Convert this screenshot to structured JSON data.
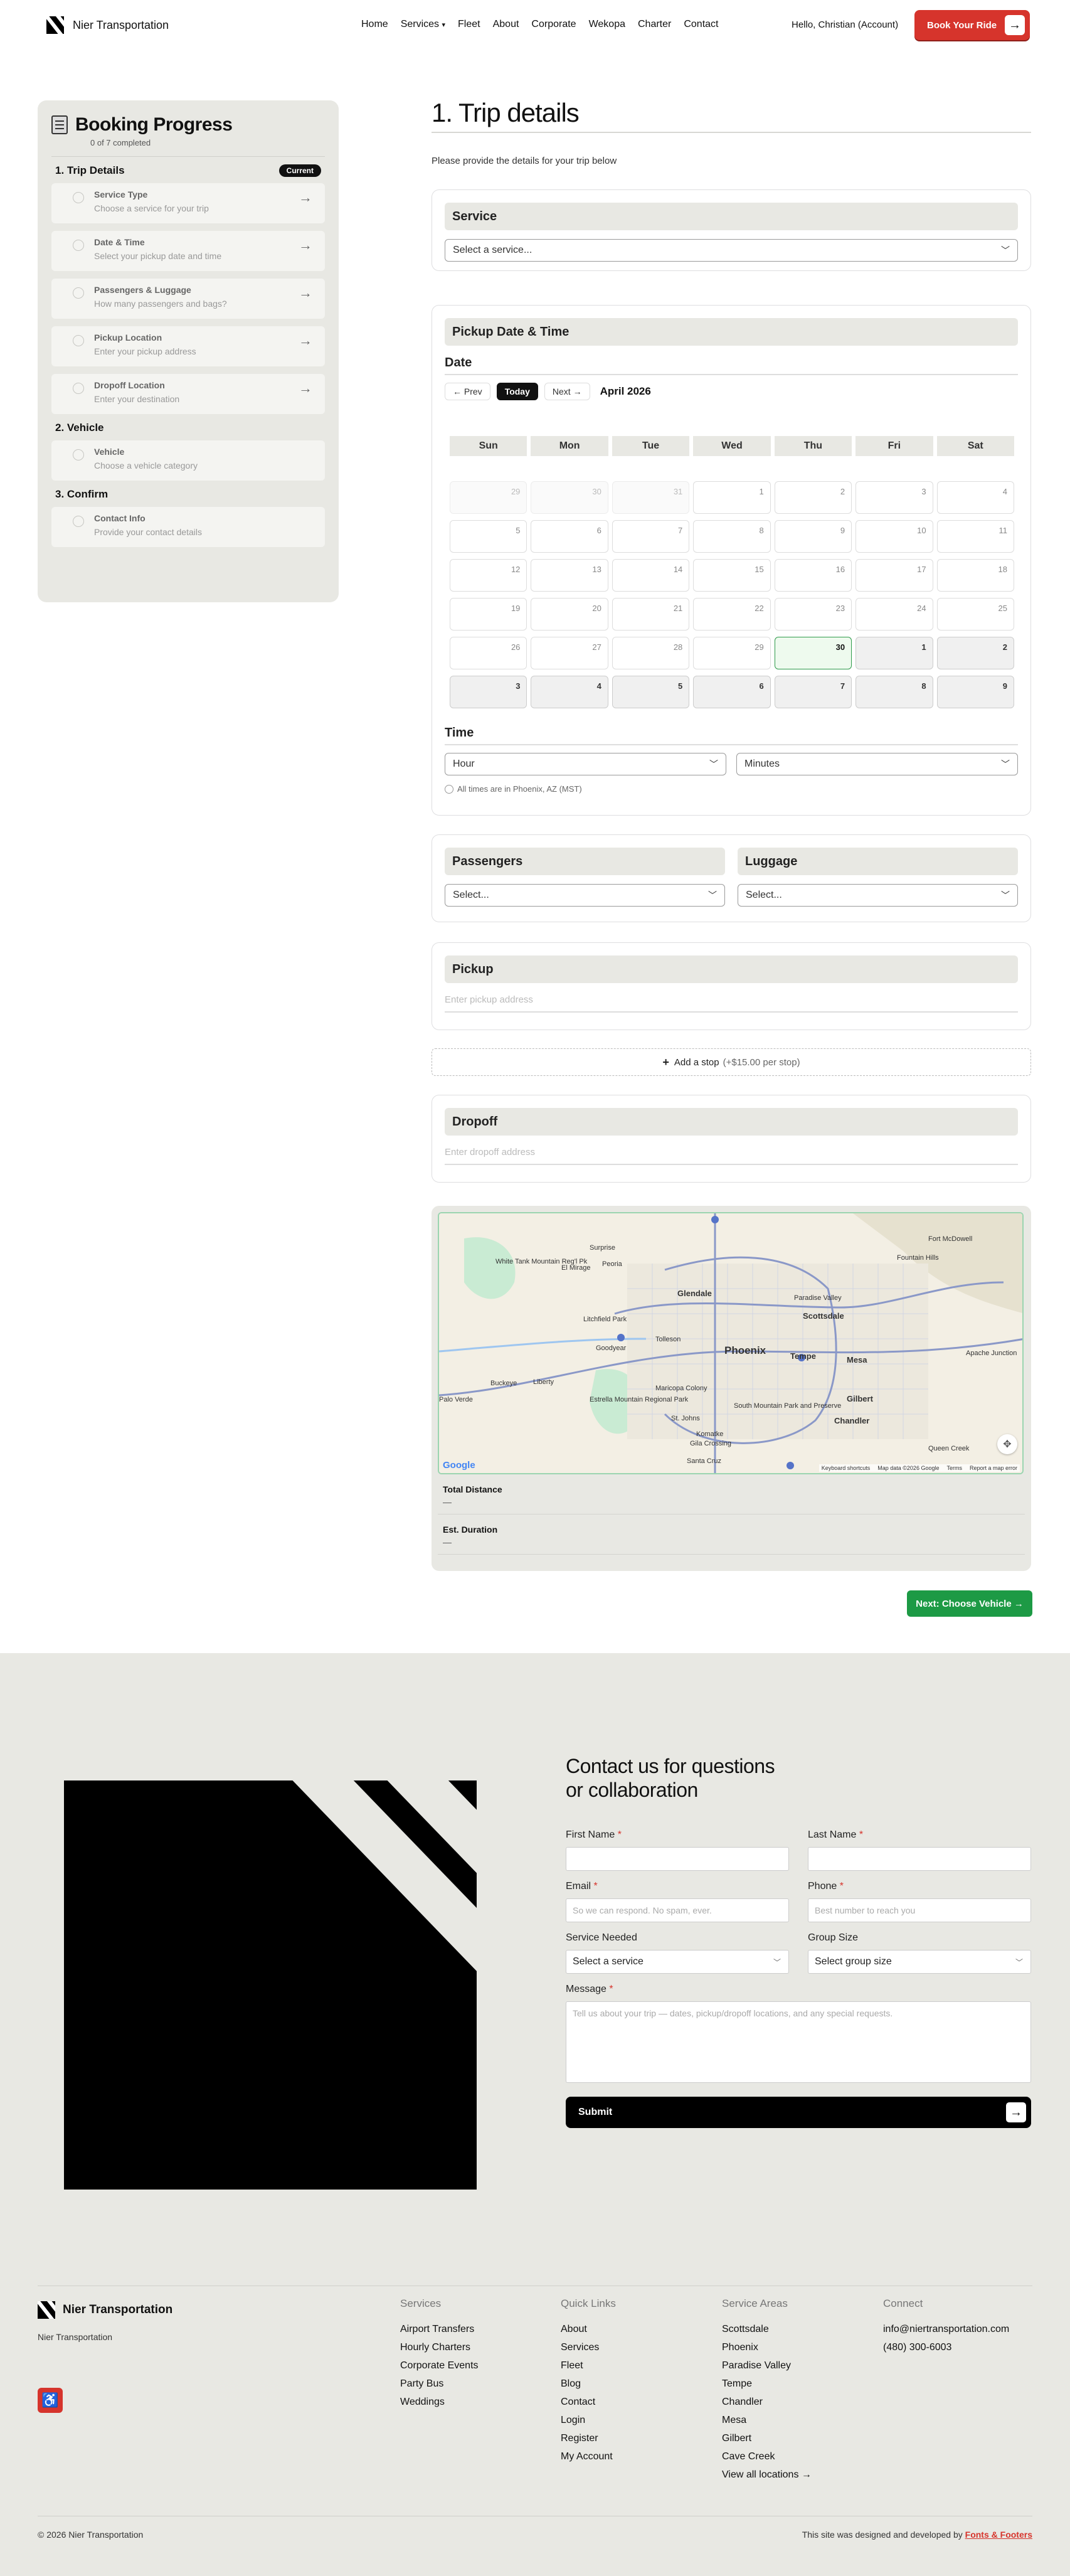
{
  "header": {
    "brand": "Nier Transportation",
    "nav": [
      "Home",
      "Services",
      "Fleet",
      "About",
      "Corporate",
      "Wekopa",
      "Charter",
      "Contact"
    ],
    "services_marker": "▾",
    "greeting": "Hello, Christian (Account)",
    "book_label": "Book Your Ride"
  },
  "sidebar": {
    "title": "Booking Progress",
    "progress": "0 of 7 completed",
    "current_badge": "Current",
    "sections": [
      {
        "title": "1.  Trip Details",
        "steps": [
          {
            "title": "Service Type",
            "desc": "Choose a service for your trip"
          },
          {
            "title": "Date & Time",
            "desc": "Select your pickup date and time"
          },
          {
            "title": "Passengers & Luggage",
            "desc": "How many passengers and bags?"
          },
          {
            "title": "Pickup Location",
            "desc": "Enter your pickup address"
          },
          {
            "title": "Dropoff Location",
            "desc": "Enter your destination"
          }
        ]
      },
      {
        "title": "2.  Vehicle",
        "steps": [
          {
            "title": "Vehicle",
            "desc": "Choose a vehicle category"
          }
        ]
      },
      {
        "title": "3.  Confirm",
        "steps": [
          {
            "title": "Contact Info",
            "desc": "Provide your contact details"
          }
        ]
      }
    ]
  },
  "main": {
    "title": "1. Trip details",
    "subtitle": "Please provide the details for your trip below",
    "service": {
      "heading": "Service",
      "select": "Select a service..."
    },
    "pickup_dt": {
      "heading": "Pickup Date & Time",
      "date_label": "Date",
      "prev": "← Prev",
      "today": "Today",
      "next": "Next →",
      "month": "April 2026",
      "weekdays": [
        "Sun",
        "Mon",
        "Tue",
        "Wed",
        "Thu",
        "Fri",
        "Sat"
      ],
      "days": [
        "29",
        "30",
        "31",
        "1",
        "2",
        "3",
        "4",
        "5",
        "6",
        "7",
        "8",
        "9",
        "10",
        "11",
        "12",
        "13",
        "14",
        "15",
        "16",
        "17",
        "18",
        "19",
        "20",
        "21",
        "22",
        "23",
        "24",
        "25",
        "26",
        "27",
        "28",
        "29",
        "30",
        "1",
        "2",
        "3",
        "4",
        "5",
        "6",
        "7",
        "8",
        "9"
      ],
      "time_label": "Time",
      "hour": "Hour",
      "minutes": "Minutes",
      "tz_note": "All times are in Phoenix, AZ (MST)"
    },
    "passengers": {
      "heading": "Passengers",
      "select": "Select..."
    },
    "luggage": {
      "heading": "Luggage",
      "select": "Select..."
    },
    "pickup": {
      "heading": "Pickup",
      "placeholder": "Enter pickup address"
    },
    "add_stop": {
      "label": "Add a stop",
      "fee": "(+$15.00 per stop)"
    },
    "dropoff": {
      "heading": "Dropoff",
      "placeholder": "Enter dropoff address"
    },
    "map": {
      "places": [
        "Surprise",
        "Fort McDowell",
        "Fountain Hills",
        "White Tank Mountain Reg'l Pk",
        "El Mirage",
        "Peoria",
        "Glendale",
        "Paradise Valley",
        "Scottsdale",
        "Litchfield Park",
        "Tolleson",
        "Goodyear",
        "Phoenix",
        "Tempe",
        "Mesa",
        "Apache Junction",
        "Palo Verde",
        "Buckeye",
        "Liberty",
        "Maricopa Colony",
        "Estrella Mountain Regional Park",
        "South Mountain Park and Preserve",
        "Gilbert",
        "Chandler",
        "St. Johns",
        "Komatke",
        "Gila Crossing",
        "Queen Creek",
        "Santa Cruz"
      ],
      "google": "Google",
      "shortcuts": "Keyboard shortcuts",
      "mapdata": "Map data ©2026 Google",
      "terms": "Terms",
      "report": "Report a map error"
    },
    "total_distance": {
      "label": "Total Distance",
      "value": "—"
    },
    "est_duration": {
      "label": "Est. Duration",
      "value": "—"
    },
    "next_button": "Next: Choose Vehicle →"
  },
  "contact": {
    "title": "Contact us for questions or collaboration",
    "first_name": "First Name",
    "last_name": "Last Name",
    "email": "Email",
    "email_ph": "So we can respond. No spam, ever.",
    "phone": "Phone",
    "phone_ph": "Best number to reach you",
    "service_needed": "Service Needed",
    "service_sel": "Select a service",
    "group_size": "Group Size",
    "group_sel": "Select group size",
    "message": "Message",
    "message_ph": "Tell us about your trip — dates, pickup/dropoff locations, and any special requests.",
    "submit": "Submit",
    "req": "*"
  },
  "footer": {
    "brand": "Nier Transportation",
    "tagline": "Nier Transportation",
    "cols": [
      {
        "h": "Services",
        "items": [
          "Airport Transfers",
          "Hourly Charters",
          "Corporate Events",
          "Party Bus",
          "Weddings"
        ]
      },
      {
        "h": "Quick Links",
        "items": [
          "About",
          "Services",
          "Fleet",
          "Blog",
          "Contact",
          "Login",
          "Register",
          "My Account"
        ]
      },
      {
        "h": "Service Areas",
        "items": [
          "Scottsdale",
          "Phoenix",
          "Paradise Valley",
          "Tempe",
          "Chandler",
          "Mesa",
          "Gilbert",
          "Cave Creek",
          "View all locations →"
        ]
      },
      {
        "h": "Connect",
        "items": [
          "info@niertransportation.com",
          "(480) 300-6003"
        ]
      }
    ],
    "copyright": "© 2026 Nier Transportation",
    "credit_prefix": "This site was designed and developed by",
    "credit_link": "Fonts & Footers"
  },
  "colors": {
    "brand_red": "#d6342c",
    "green": "#1d9a45",
    "panel": "#e8e8e3"
  }
}
